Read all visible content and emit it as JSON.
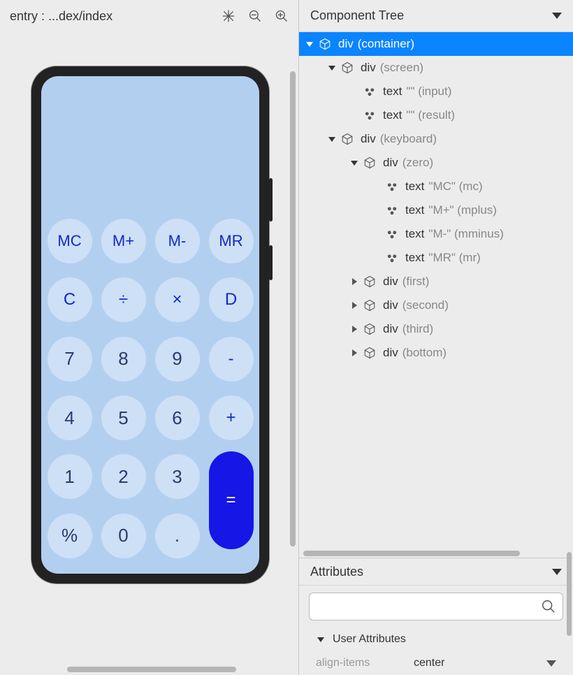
{
  "preview": {
    "title": "entry : ...dex/index"
  },
  "calculator": {
    "keys": {
      "mc": "MC",
      "mplus": "M+",
      "mminus": "M-",
      "mr": "MR",
      "c": "C",
      "div": "÷",
      "mul": "×",
      "d": "D",
      "k7": "7",
      "k8": "8",
      "k9": "9",
      "minus": "-",
      "k4": "4",
      "k5": "5",
      "k6": "6",
      "plus": "+",
      "k1": "1",
      "k2": "2",
      "k3": "3",
      "pct": "%",
      "k0": "0",
      "dot": ".",
      "eq": "="
    }
  },
  "tree": {
    "title": "Component Tree",
    "nodes": [
      {
        "indent": 0,
        "arrow": "open",
        "icon": "cube",
        "tag": "div",
        "hint": "(container)",
        "selected": true
      },
      {
        "indent": 1,
        "arrow": "open",
        "icon": "cube",
        "tag": "div",
        "hint": "(screen)"
      },
      {
        "indent": 2,
        "arrow": "",
        "icon": "leaf",
        "tag": "text",
        "hint": "\"\" (input)"
      },
      {
        "indent": 2,
        "arrow": "",
        "icon": "leaf",
        "tag": "text",
        "hint": "\"\" (result)"
      },
      {
        "indent": 1,
        "arrow": "open",
        "icon": "cube",
        "tag": "div",
        "hint": "(keyboard)"
      },
      {
        "indent": 2,
        "arrow": "open",
        "icon": "cube",
        "tag": "div",
        "hint": "(zero)"
      },
      {
        "indent": 3,
        "arrow": "",
        "icon": "leaf",
        "tag": "text",
        "hint": "\"MC\" (mc)"
      },
      {
        "indent": 3,
        "arrow": "",
        "icon": "leaf",
        "tag": "text",
        "hint": "\"M+\" (mplus)"
      },
      {
        "indent": 3,
        "arrow": "",
        "icon": "leaf",
        "tag": "text",
        "hint": "\"M-\" (mminus)"
      },
      {
        "indent": 3,
        "arrow": "",
        "icon": "leaf",
        "tag": "text",
        "hint": "\"MR\" (mr)"
      },
      {
        "indent": 2,
        "arrow": "closed",
        "icon": "cube",
        "tag": "div",
        "hint": "(first)"
      },
      {
        "indent": 2,
        "arrow": "closed",
        "icon": "cube",
        "tag": "div",
        "hint": "(second)"
      },
      {
        "indent": 2,
        "arrow": "closed",
        "icon": "cube",
        "tag": "div",
        "hint": "(third)"
      },
      {
        "indent": 2,
        "arrow": "closed",
        "icon": "cube",
        "tag": "div",
        "hint": "(bottom)"
      }
    ]
  },
  "attributes": {
    "title": "Attributes",
    "search_placeholder": "",
    "subsection": "User Attributes",
    "rows": [
      {
        "name": "align-items",
        "value": "center"
      }
    ]
  }
}
